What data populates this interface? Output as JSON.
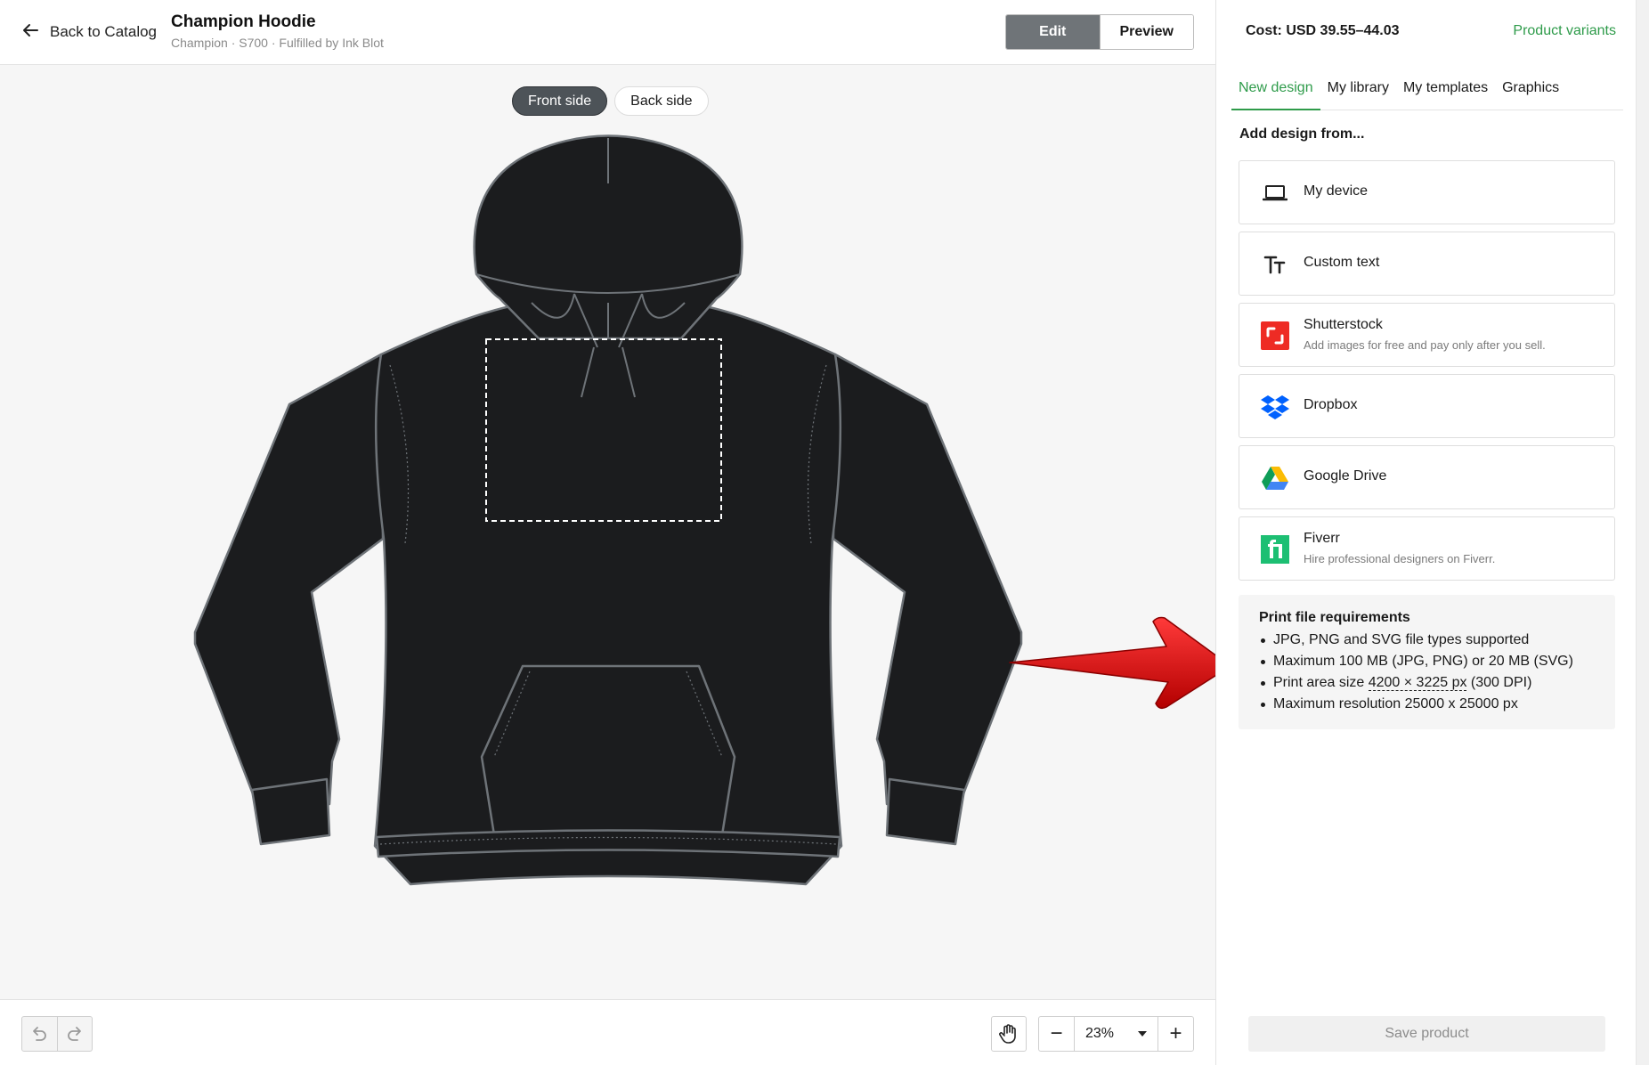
{
  "header": {
    "back_label": "Back to Catalog",
    "title": "Champion Hoodie",
    "subtitle": "Champion · S700 · Fulfilled by Ink Blot",
    "edit_label": "Edit",
    "preview_label": "Preview"
  },
  "canvas": {
    "front_label": "Front side",
    "back_label": "Back side"
  },
  "toolbar": {
    "zoom_value": "23%"
  },
  "panel": {
    "cost": "Cost: USD 39.55–44.03",
    "variants_link": "Product variants",
    "tabs": [
      {
        "label": "New design"
      },
      {
        "label": "My library"
      },
      {
        "label": "My templates"
      },
      {
        "label": "Graphics"
      }
    ],
    "add_heading": "Add design from...",
    "sources": [
      {
        "name": "My device",
        "desc": ""
      },
      {
        "name": "Custom text",
        "desc": ""
      },
      {
        "name": "Shutterstock",
        "desc": "Add images for free and pay only after you sell."
      },
      {
        "name": "Dropbox",
        "desc": ""
      },
      {
        "name": "Google Drive",
        "desc": ""
      },
      {
        "name": "Fiverr",
        "desc": "Hire professional designers on Fiverr."
      }
    ],
    "requirements": {
      "title": "Print file requirements",
      "items": [
        "JPG, PNG and SVG file types supported",
        "Maximum 100 MB (JPG, PNG) or 20 MB (SVG)",
        "Print area size ",
        "Maximum resolution 25000 x 25000 px"
      ],
      "print_area_value": "4200 × 3225 px",
      "print_area_suffix": " (300 DPI)"
    },
    "save_label": "Save product"
  },
  "colors": {
    "accent_green": "#2e9b4a",
    "hoodie_fill": "#1b1c1e",
    "arrow_red": "#d40f0f",
    "shutterstock_red": "#ee2b24",
    "dropbox_blue": "#0061fe",
    "fiverr_green": "#1dbf73"
  }
}
